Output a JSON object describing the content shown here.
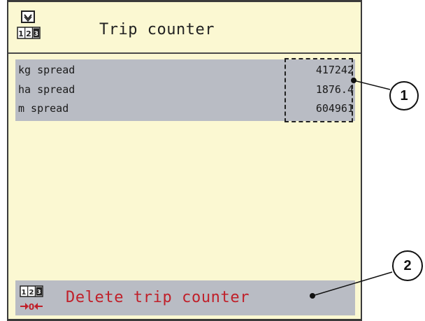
{
  "header": {
    "title": "Trip counter",
    "icon": "trip-counter-icon"
  },
  "counters": [
    {
      "label": "kg spread",
      "value": "417242"
    },
    {
      "label": "ha spread",
      "value": "1876.4"
    },
    {
      "label": "m spread",
      "value": "604961"
    }
  ],
  "footer": {
    "label": "Delete trip counter",
    "icon": "reset-counter-icon"
  },
  "callouts": [
    "1",
    "2"
  ],
  "colors": {
    "screen_bg": "#fbf8d2",
    "panel_bg": "#b9bcc4",
    "delete_text": "#c0202a"
  }
}
